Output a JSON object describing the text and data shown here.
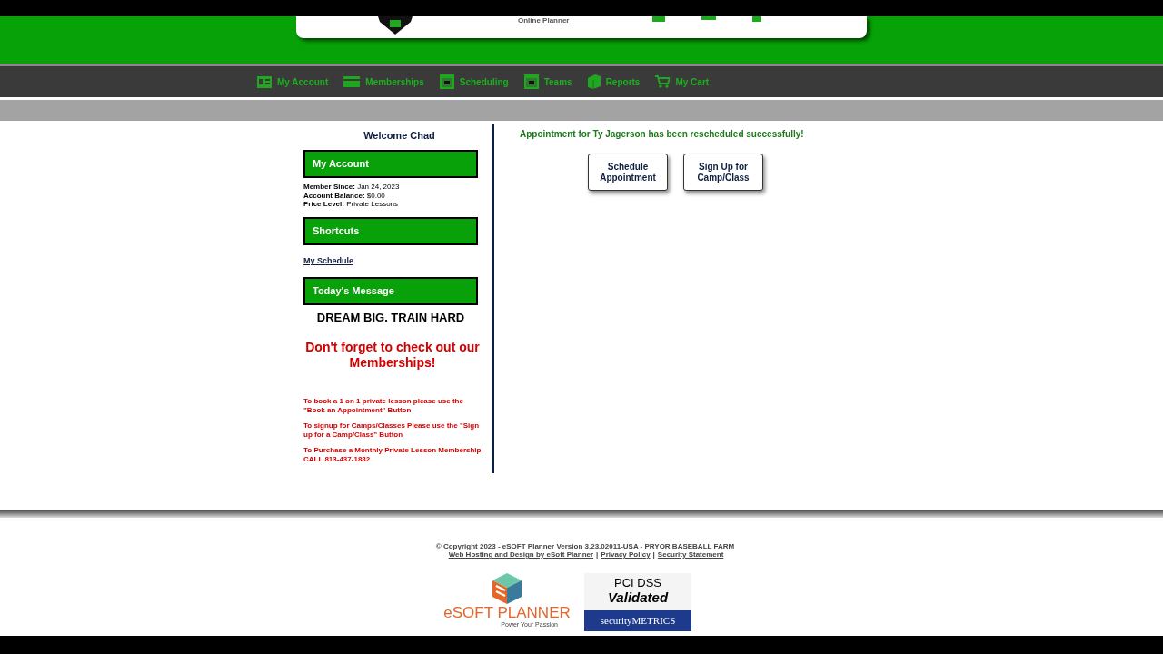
{
  "header": {
    "tagline": "Online Planner"
  },
  "nav": [
    {
      "label": "My Account"
    },
    {
      "label": "Memberships"
    },
    {
      "label": "Scheduling"
    },
    {
      "label": "Teams"
    },
    {
      "label": "Reports"
    },
    {
      "label": "My Cart"
    }
  ],
  "sidebar": {
    "welcome": "Welcome Chad",
    "account_title": "My Account",
    "account_fields": [
      {
        "label": "Member Since:",
        "value": "Jan 24, 2023"
      },
      {
        "label": "Account Balance:",
        "value": "$0.00"
      },
      {
        "label": "Price Level:",
        "value": "Private Lessons"
      }
    ],
    "shortcuts_title": "Shortcuts",
    "shortcuts": [
      "My Schedule"
    ],
    "message_title": "Today's Message",
    "motto": "DREAM BIG. TRAIN HARD",
    "promo": "Don't forget to check out our Memberships!",
    "notes": [
      "To book a 1 on 1 private lesson please use the \"Book an Appointment\" Button",
      "To signup for Camps/Classes Please use the \"Sign up for a Camp/Class\" Button",
      "To Purchase a Monthly Private Lesson Membership- CALL 813-437-1882"
    ]
  },
  "main": {
    "success_message": "Appointment for Ty Jagerson has been rescheduled successfully!",
    "buttons": [
      "Schedule Appointment",
      "Sign Up for Camp/Class"
    ]
  },
  "footer": {
    "copyright": "© Copyright 2023 - eSOFT Planner Version 3.23.02011-USA - PRYOR BASEBALL FARM",
    "links": [
      "Web Hosting and Design by eSoft Planner",
      "Privacy Policy",
      "Security Statement"
    ],
    "link_separators": [
      "|",
      "|"
    ],
    "esoft_logo": {
      "name": "eSOFT PLANNER",
      "slogan": "Power Your Passion"
    },
    "pci_badge": {
      "line1": "PCI DSS",
      "line2": "Validated",
      "brand": "securityMETRICS"
    }
  }
}
